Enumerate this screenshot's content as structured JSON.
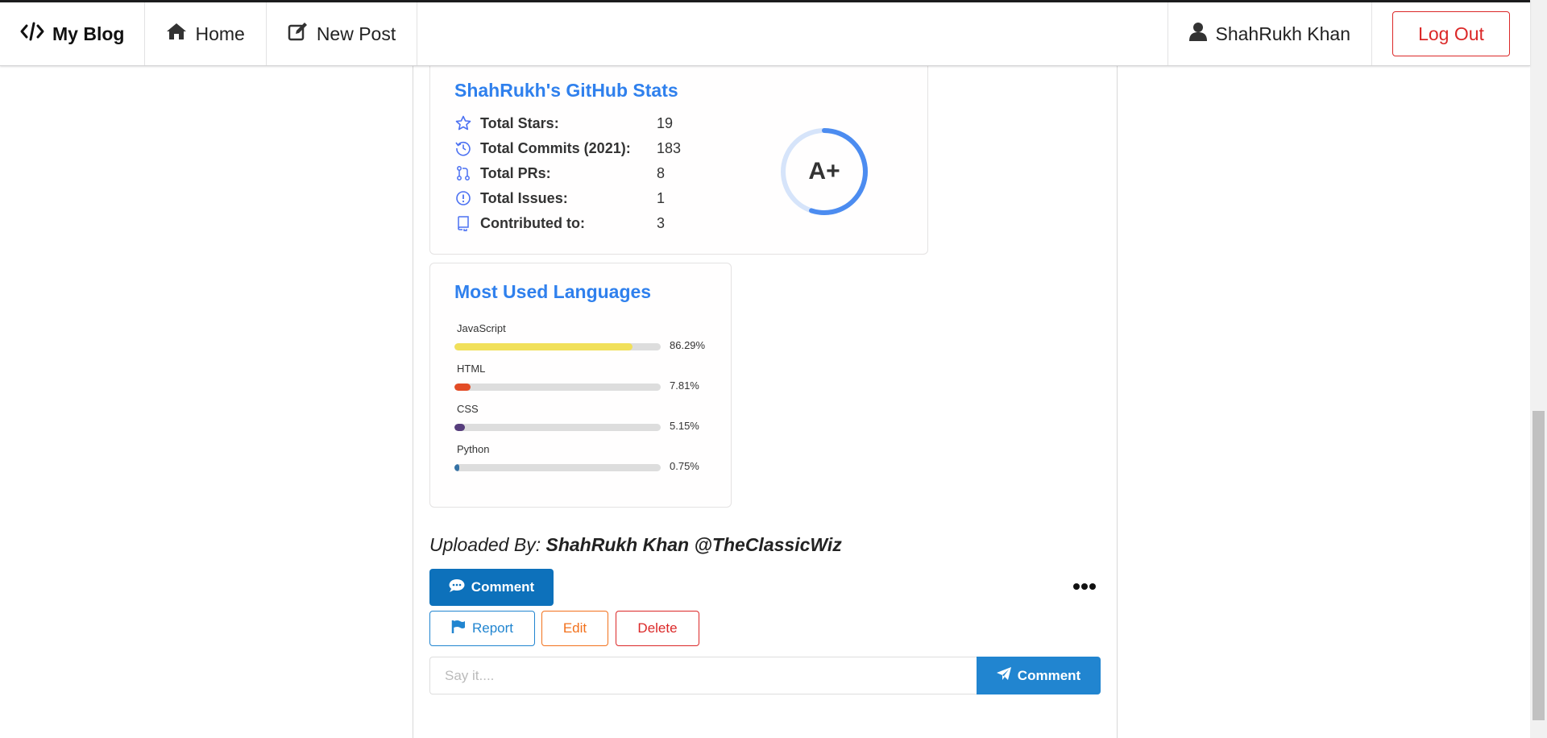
{
  "navbar": {
    "brand": "My Blog",
    "home": "Home",
    "new_post": "New Post",
    "user": "ShahRukh Khan",
    "logout": "Log Out"
  },
  "stats": {
    "title": "ShahRukh's GitHub Stats",
    "rows": [
      {
        "icon": "star-icon",
        "label": "Total Stars:",
        "value": "19"
      },
      {
        "icon": "history-icon",
        "label": "Total Commits (2021):",
        "value": "183"
      },
      {
        "icon": "pull-request-icon",
        "label": "Total PRs:",
        "value": "8"
      },
      {
        "icon": "issue-icon",
        "label": "Total Issues:",
        "value": "1"
      },
      {
        "icon": "repo-icon",
        "label": "Contributed to:",
        "value": "3"
      }
    ],
    "rank": "A+",
    "rank_progress": 0.55
  },
  "languages": {
    "title": "Most Used Languages",
    "items": [
      {
        "name": "JavaScript",
        "percent": "86.29%",
        "value": 86.29,
        "color": "#f1e05a"
      },
      {
        "name": "HTML",
        "percent": "7.81%",
        "value": 7.81,
        "color": "#e34c26"
      },
      {
        "name": "CSS",
        "percent": "5.15%",
        "value": 5.15,
        "color": "#563d7c"
      },
      {
        "name": "Python",
        "percent": "0.75%",
        "value": 0.75,
        "color": "#3572A5"
      }
    ]
  },
  "post": {
    "uploaded_prefix": "Uploaded By:",
    "uploaded_by": "ShahRukh Khan @TheClassicWiz",
    "comment_button": "Comment",
    "report_button": "Report",
    "edit_button": "Edit",
    "delete_button": "Delete"
  },
  "comment_form": {
    "placeholder": "Say it....",
    "value": "",
    "submit": "Comment"
  },
  "colors": {
    "accent": "#2f80ed",
    "primary_button": "#0d71bb",
    "danger": "#db2828",
    "warning": "#f2711c"
  }
}
